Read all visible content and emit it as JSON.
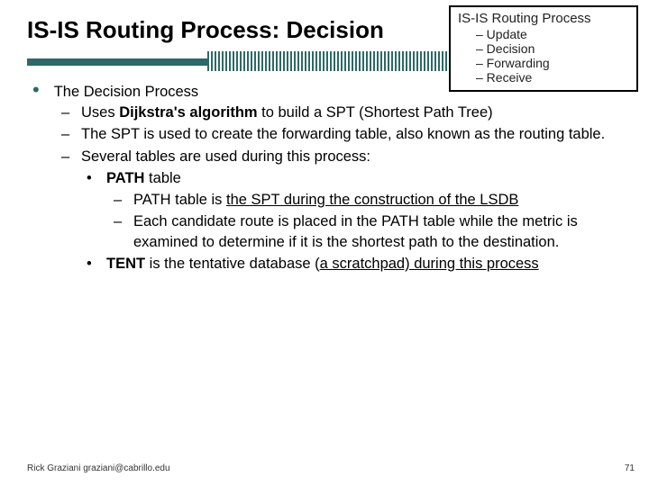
{
  "title": "IS-IS Routing Process: Decision",
  "callout": {
    "title": "IS-IS Routing Process",
    "items": [
      "– Update",
      "– Decision",
      "– Forwarding",
      "– Receive"
    ]
  },
  "content": {
    "p1": "The Decision Process",
    "p2_a": "Uses ",
    "p2_b": "Dijkstra's algorithm",
    "p2_c": " to build a SPT (Shortest Path Tree)",
    "p3": "The SPT is used to create the forwarding table, also known as the routing table.",
    "p4": "Several tables are used during this process:",
    "p5_a": "PATH",
    "p5_b": " table",
    "p6_a": "PATH table is ",
    "p6_b": "the SPT during the construction of the LSDB",
    "p7": "Each candidate route is placed in the PATH table while the metric is examined to determine if it is the shortest path to the destination.",
    "p8_a": "TENT",
    "p8_b": " is the tentative database (",
    "p8_c": "a scratchpad) during this process"
  },
  "footer": "Rick Graziani  graziani@cabrillo.edu",
  "page": "71"
}
